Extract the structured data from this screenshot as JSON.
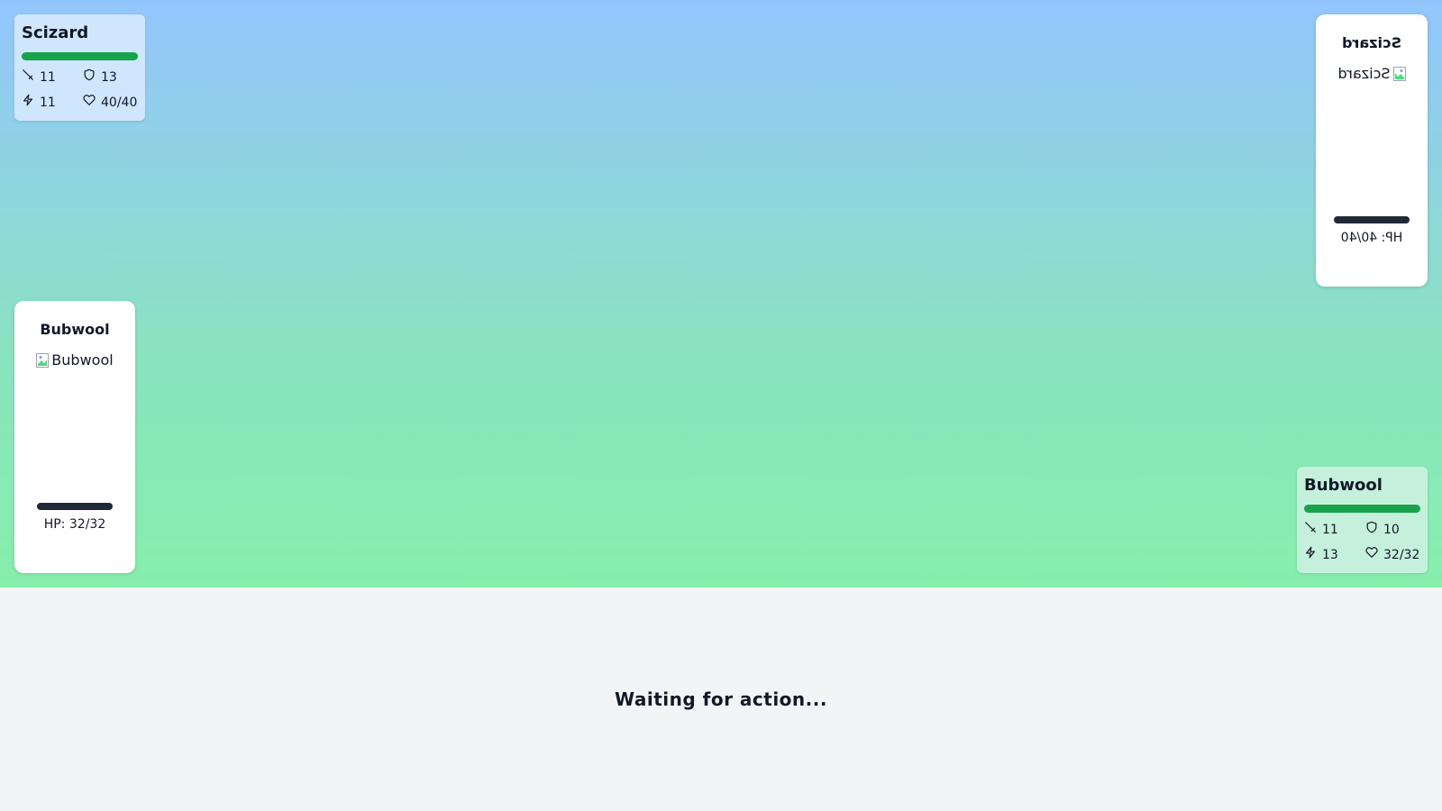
{
  "enemy": {
    "name": "Scizard",
    "hp_fraction": 1.0,
    "stats": {
      "attack": "11",
      "defense": "13",
      "speed": "11",
      "hp": "40/40"
    },
    "card": {
      "name": "Scizard",
      "image_alt": "Scizard",
      "hp_text": "HP: 40/40"
    }
  },
  "player": {
    "name": "Bubwool",
    "hp_fraction": 1.0,
    "stats": {
      "attack": "11",
      "defense": "10",
      "speed": "13",
      "hp": "32/32"
    },
    "card": {
      "name": "Bubwool",
      "image_alt": "Bubwool",
      "hp_text": "HP: 32/32"
    }
  },
  "status_text": "Waiting for action...",
  "colors": {
    "hp_bar": "#16a34a",
    "card_hp_bar": "#1f2937",
    "enemy_panel": "#cfe6fc",
    "player_panel": "#c4f0dc"
  },
  "icons": [
    "sword-icon",
    "shield-icon",
    "lightning-icon",
    "heart-icon",
    "broken-image-icon"
  ]
}
